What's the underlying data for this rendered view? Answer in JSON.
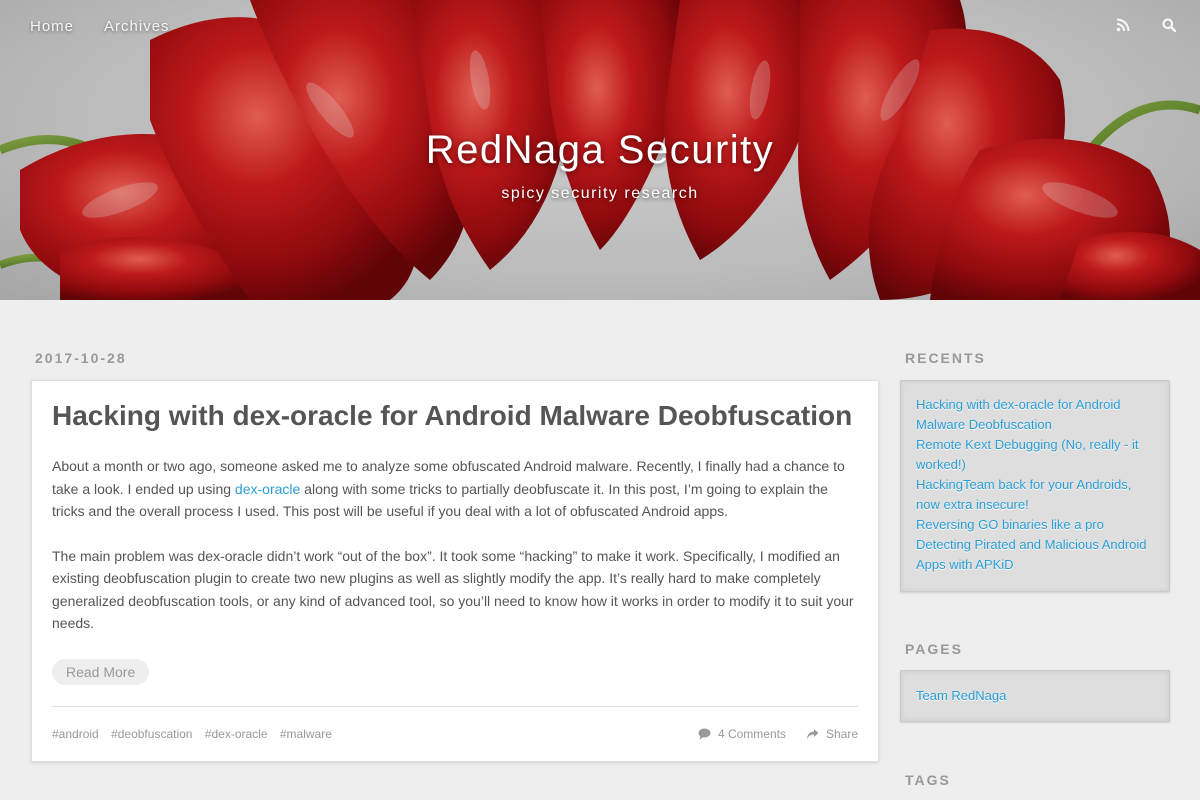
{
  "nav": {
    "links": [
      {
        "label": "Home"
      },
      {
        "label": "Archives"
      }
    ],
    "icons": [
      "rss-icon",
      "search-icon"
    ]
  },
  "site": {
    "title": "RedNaga Security",
    "subtitle": "spicy security research"
  },
  "post": {
    "date": "2017-10-28",
    "title": "Hacking with dex-oracle for Android Malware Deobfuscation",
    "p1_before": "About a month or two ago, someone asked me to analyze some obfuscated Android malware. Recently, I finally had a chance to take a look. I ended up using ",
    "p1_link": "dex-oracle",
    "p1_after": " along with some tricks to partially deobfuscate it. In this post, I’m going to explain the tricks and the overall process I used. This post will be useful if you deal with a lot of obfuscated Android apps.",
    "p2": "The main problem was dex-oracle didn’t work “out of the box”. It took some “hacking” to make it work. Specifically, I modified an existing deobfuscation plugin to create two new plugins as well as slightly modify the app. It’s really hard to make completely generalized deobfuscation tools, or any kind of advanced tool, so you’ll need to know how it works in order to modify it to suit your needs.",
    "read_more": "Read More",
    "tags": [
      "#android",
      "#deobfuscation",
      "#dex-oracle",
      "#malware"
    ],
    "comments": "4 Comments",
    "share": "Share"
  },
  "sidebar": {
    "recents_heading": "RECENTS",
    "recents": [
      "Hacking with dex-oracle for Android Malware Deobfuscation",
      "Remote Kext Debugging (No, really - it worked!)",
      "HackingTeam back for your Androids, now extra insecure!",
      "Reversing GO binaries like a pro",
      "Detecting Pirated and Malicious Android Apps with APKiD"
    ],
    "pages_heading": "PAGES",
    "pages": [
      "Team RedNaga"
    ],
    "tags_heading": "TAGS"
  },
  "colors": {
    "accent": "#2a9fd6",
    "pepper": "#c8151a",
    "background": "#eeeeee"
  }
}
